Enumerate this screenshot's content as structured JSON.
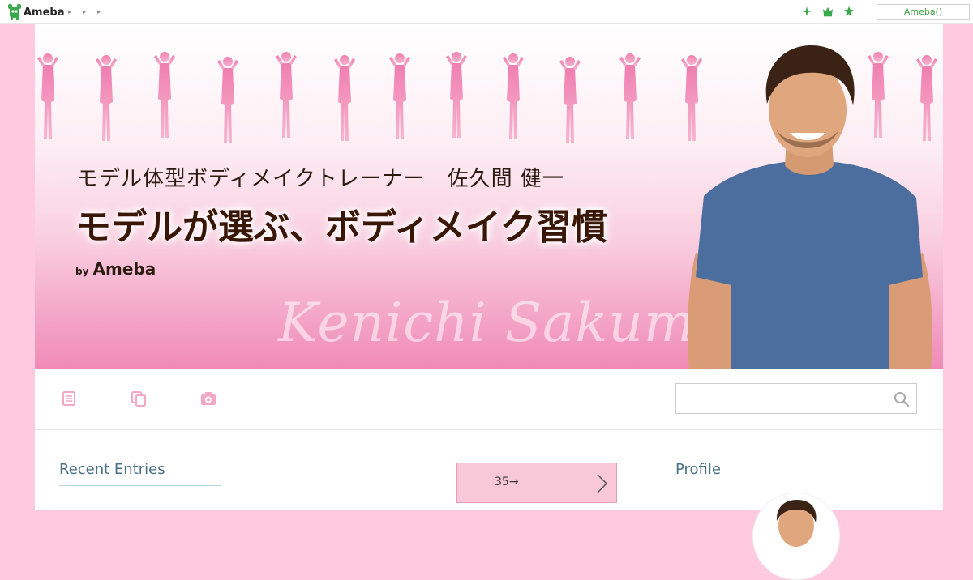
{
  "topbar": {
    "logo_text": "Ameba",
    "button_label": "Ameba()"
  },
  "header": {
    "subtitle": "モデル体型ボディメイクトレーナー　佐久間 健一",
    "title": "モデルが選ぶ、ボディメイク習慣",
    "by": "by",
    "brand": "Ameba",
    "signature": "Kenichi Sakuma"
  },
  "nav": {
    "icons": [
      "entry-list-icon",
      "copy-icon",
      "camera-icon"
    ]
  },
  "search": {
    "placeholder": ""
  },
  "sidebar": {
    "recent_entries": "Recent Entries"
  },
  "pager": {
    "label": "35→"
  },
  "profile": {
    "title": "Profile"
  },
  "colors": {
    "brand_green": "#43a047",
    "page_background": "#ffc9df",
    "heading_blue": "#4a6f86",
    "pager_fill": "#f9c8d8"
  }
}
